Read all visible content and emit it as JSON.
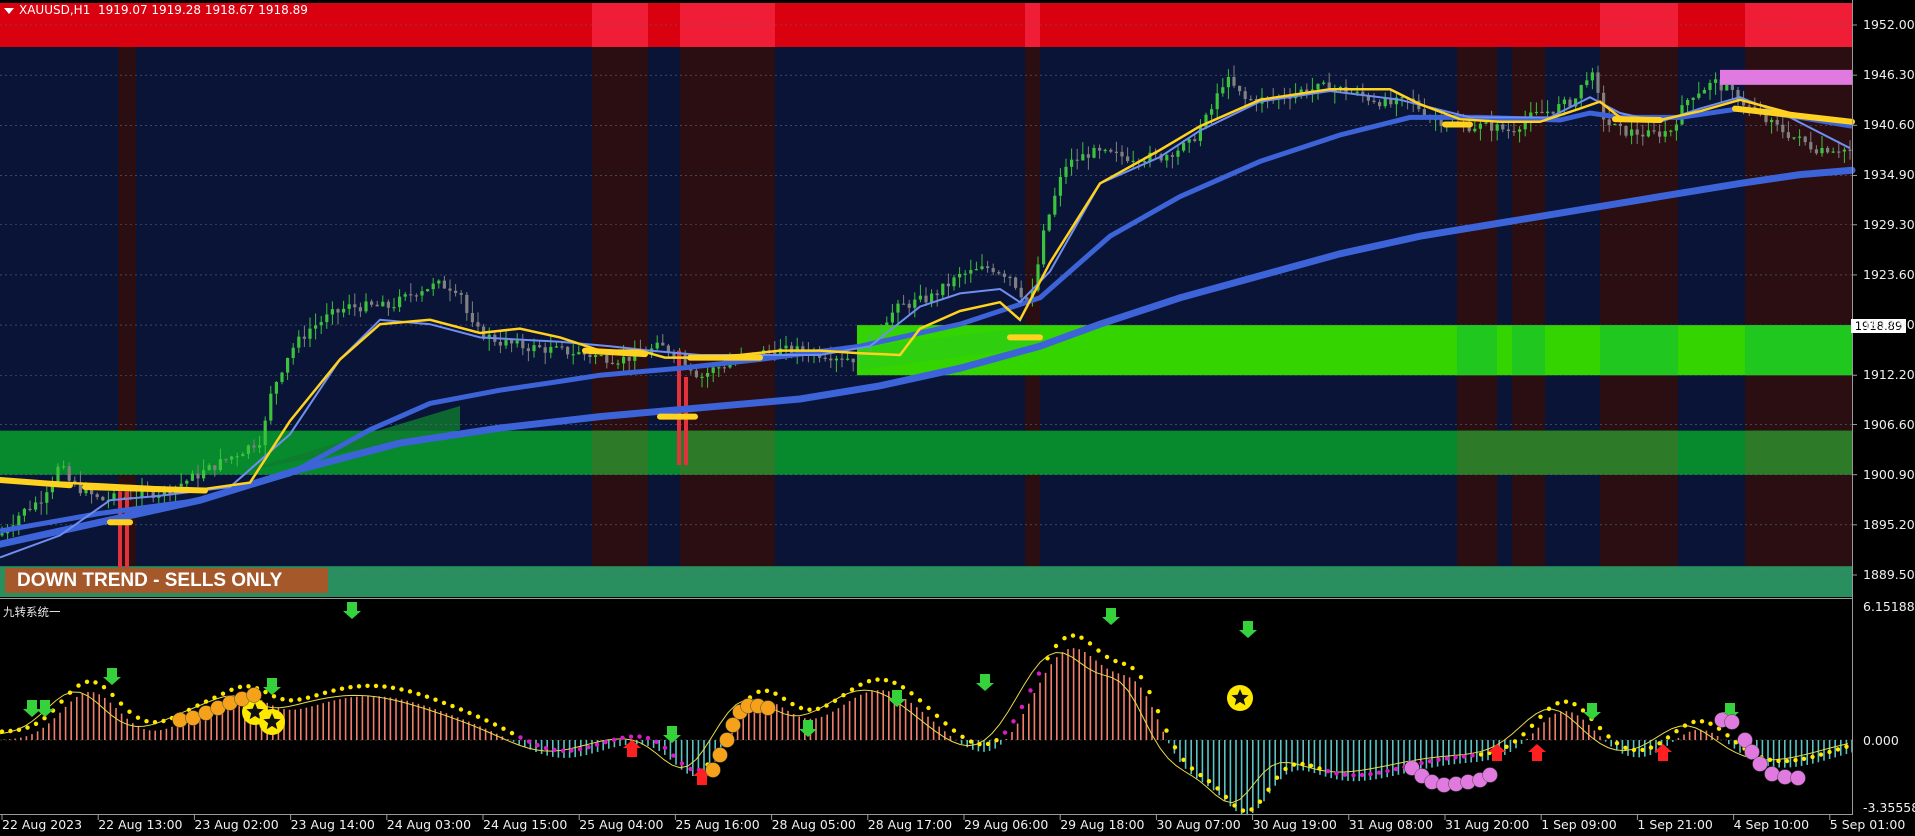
{
  "header": {
    "symbol": "XAUUSD,H1",
    "ohlc": "1919.07 1919.28 1918.67 1918.89"
  },
  "banner": {
    "text": "DOWN TREND - SELLS ONLY"
  },
  "price_axis": {
    "ticks": [
      "1952.00",
      "1946.30",
      "1940.60",
      "1934.90",
      "1929.30",
      "1923.60",
      "1917.90",
      "1912.20",
      "1906.60",
      "1900.90",
      "1895.20",
      "1889.50"
    ],
    "current_price": "1918.89"
  },
  "indicator": {
    "name": "九转系统一",
    "max_label": "6.15188",
    "zero_label": "0.000",
    "min_label": "-3.355586"
  },
  "time_axis": {
    "ticks": [
      "22 Aug 2023",
      "22 Aug 13:00",
      "23 Aug 02:00",
      "23 Aug 14:00",
      "24 Aug 03:00",
      "24 Aug 15:00",
      "25 Aug 04:00",
      "25 Aug 16:00",
      "28 Aug 05:00",
      "28 Aug 17:00",
      "29 Aug 06:00",
      "29 Aug 18:00",
      "30 Aug 07:00",
      "30 Aug 19:00",
      "31 Aug 08:00",
      "31 Aug 20:00",
      "1 Sep 09:00",
      "1 Sep 21:00",
      "4 Sep 10:00",
      "5 Sep 01:00"
    ]
  },
  "colors": {
    "background": "#000000",
    "main_bg": "#0a1436",
    "bull_candle": "#3cc23c",
    "bear_candle": "#808080",
    "fast_ma": "#ffd21f",
    "slow_ma": "#3d63d8",
    "resistance_band": "#d9000f",
    "support_zone_bright": "#33d400",
    "support_zone_dark": "#078a2e"
  },
  "chart_data": {
    "type": "candlestick",
    "symbol": "XAUUSD",
    "timeframe": "H1",
    "ylim": [
      1887.0,
      1954.5
    ],
    "last_price": 1918.89,
    "close_path": [
      [
        0,
        1894
      ],
      [
        20,
        1896.5
      ],
      [
        40,
        1898
      ],
      [
        60,
        1902
      ],
      [
        70,
        1900
      ],
      [
        85,
        1899
      ],
      [
        100,
        1898
      ],
      [
        130,
        1898.5
      ],
      [
        165,
        1899
      ],
      [
        200,
        1901
      ],
      [
        240,
        1903.5
      ],
      [
        262,
        1905
      ],
      [
        272,
        1910.5
      ],
      [
        290,
        1915
      ],
      [
        310,
        1917.5
      ],
      [
        330,
        1919
      ],
      [
        350,
        1920
      ],
      [
        370,
        1920
      ],
      [
        390,
        1920
      ],
      [
        420,
        1922
      ],
      [
        440,
        1922.5
      ],
      [
        460,
        1922
      ],
      [
        470,
        1918
      ],
      [
        480,
        1917
      ],
      [
        500,
        1916
      ],
      [
        520,
        1915.5
      ],
      [
        560,
        1915
      ],
      [
        590,
        1914.5
      ],
      [
        620,
        1914
      ],
      [
        640,
        1914.5
      ],
      [
        660,
        1915.5
      ],
      [
        680,
        1914.5
      ],
      [
        700,
        1912
      ],
      [
        715,
        1913
      ],
      [
        740,
        1914
      ],
      [
        770,
        1915
      ],
      [
        800,
        1915
      ],
      [
        830,
        1914.5
      ],
      [
        860,
        1914
      ],
      [
        868,
        1916
      ],
      [
        880,
        1918
      ],
      [
        900,
        1920
      ],
      [
        930,
        1921
      ],
      [
        960,
        1923.5
      ],
      [
        990,
        1924.5
      ],
      [
        1010,
        1923.5
      ],
      [
        1030,
        1920
      ],
      [
        1045,
        1929
      ],
      [
        1065,
        1936
      ],
      [
        1090,
        1937.5
      ],
      [
        1130,
        1937
      ],
      [
        1160,
        1937
      ],
      [
        1190,
        1938.5
      ],
      [
        1210,
        1942
      ],
      [
        1225,
        1946
      ],
      [
        1245,
        1943.5
      ],
      [
        1270,
        1943.5
      ],
      [
        1300,
        1944.5
      ],
      [
        1330,
        1945
      ],
      [
        1360,
        1944
      ],
      [
        1390,
        1943
      ],
      [
        1410,
        1943.5
      ],
      [
        1430,
        1941.5
      ],
      [
        1460,
        1940.5
      ],
      [
        1490,
        1940.5
      ],
      [
        1510,
        1940
      ],
      [
        1530,
        1941.5
      ],
      [
        1555,
        1942.5
      ],
      [
        1575,
        1943.5
      ],
      [
        1590,
        1947
      ],
      [
        1605,
        1941
      ],
      [
        1620,
        1940
      ],
      [
        1650,
        1939.5
      ],
      [
        1670,
        1940
      ],
      [
        1690,
        1944
      ],
      [
        1715,
        1945.5
      ],
      [
        1735,
        1944
      ],
      [
        1760,
        1941.5
      ],
      [
        1790,
        1939.5
      ],
      [
        1815,
        1938
      ],
      [
        1840,
        1938
      ],
      [
        1852,
        1937.5
      ]
    ],
    "fast_ma": [
      [
        0,
        1900.3
      ],
      [
        100,
        1899.8
      ],
      [
        200,
        1899.2
      ],
      [
        250,
        1900
      ],
      [
        290,
        1907
      ],
      [
        340,
        1914
      ],
      [
        380,
        1918
      ],
      [
        430,
        1918.5
      ],
      [
        480,
        1917
      ],
      [
        520,
        1917.5
      ],
      [
        560,
        1916.5
      ],
      [
        600,
        1915
      ],
      [
        640,
        1915
      ],
      [
        665,
        1914.2
      ],
      [
        700,
        1914.2
      ],
      [
        740,
        1914.5
      ],
      [
        780,
        1915
      ],
      [
        820,
        1915
      ],
      [
        860,
        1914.7
      ],
      [
        900,
        1914.5
      ],
      [
        920,
        1917.5
      ],
      [
        960,
        1919.5
      ],
      [
        1000,
        1920.5
      ],
      [
        1020,
        1918.5
      ],
      [
        1050,
        1925
      ],
      [
        1100,
        1934
      ],
      [
        1160,
        1937.8
      ],
      [
        1200,
        1940.5
      ],
      [
        1260,
        1943.5
      ],
      [
        1330,
        1944.7
      ],
      [
        1390,
        1944.7
      ],
      [
        1420,
        1943
      ],
      [
        1460,
        1941.3
      ],
      [
        1500,
        1941
      ],
      [
        1540,
        1941
      ],
      [
        1580,
        1942.5
      ],
      [
        1600,
        1943.3
      ],
      [
        1620,
        1941.5
      ],
      [
        1660,
        1941.2
      ],
      [
        1700,
        1942.2
      ],
      [
        1740,
        1943.5
      ],
      [
        1790,
        1942
      ],
      [
        1850,
        1941
      ]
    ],
    "mid_ma": [
      [
        0,
        1891.5
      ],
      [
        60,
        1894
      ],
      [
        110,
        1898
      ],
      [
        160,
        1898.5
      ],
      [
        230,
        1899.5
      ],
      [
        290,
        1905.5
      ],
      [
        340,
        1914
      ],
      [
        380,
        1918.5
      ],
      [
        430,
        1918
      ],
      [
        480,
        1916.5
      ],
      [
        560,
        1916
      ],
      [
        610,
        1915.5
      ],
      [
        650,
        1915
      ],
      [
        700,
        1914.5
      ],
      [
        760,
        1914.5
      ],
      [
        820,
        1914.5
      ],
      [
        870,
        1915.5
      ],
      [
        920,
        1920
      ],
      [
        960,
        1921.5
      ],
      [
        1000,
        1922
      ],
      [
        1020,
        1920.5
      ],
      [
        1050,
        1924
      ],
      [
        1100,
        1934
      ],
      [
        1160,
        1937
      ],
      [
        1200,
        1940
      ],
      [
        1260,
        1943.3
      ],
      [
        1330,
        1944.5
      ],
      [
        1400,
        1943.5
      ],
      [
        1470,
        1941.5
      ],
      [
        1550,
        1941.5
      ],
      [
        1590,
        1943.8
      ],
      [
        1620,
        1942
      ],
      [
        1660,
        1941
      ],
      [
        1700,
        1942.5
      ],
      [
        1740,
        1943.8
      ],
      [
        1790,
        1941.5
      ],
      [
        1850,
        1938
      ]
    ],
    "slow_ma": [
      [
        0,
        1894.5
      ],
      [
        100,
        1896.5
      ],
      [
        200,
        1898
      ],
      [
        290,
        1901
      ],
      [
        370,
        1906
      ],
      [
        430,
        1909
      ],
      [
        500,
        1910.5
      ],
      [
        560,
        1911.5
      ],
      [
        600,
        1912.2
      ],
      [
        680,
        1913
      ],
      [
        760,
        1914
      ],
      [
        860,
        1915.5
      ],
      [
        960,
        1918
      ],
      [
        1040,
        1921
      ],
      [
        1110,
        1928
      ],
      [
        1180,
        1932.5
      ],
      [
        1260,
        1936.5
      ],
      [
        1340,
        1939.5
      ],
      [
        1410,
        1941.5
      ],
      [
        1480,
        1941.5
      ],
      [
        1560,
        1941.2
      ],
      [
        1590,
        1942
      ],
      [
        1620,
        1941.5
      ],
      [
        1680,
        1941.5
      ],
      [
        1740,
        1942.5
      ],
      [
        1800,
        1941.5
      ],
      [
        1852,
        1940.5
      ]
    ],
    "long_ma": [
      [
        0,
        1893
      ],
      [
        100,
        1895.5
      ],
      [
        200,
        1898
      ],
      [
        300,
        1901.5
      ],
      [
        400,
        1904.5
      ],
      [
        500,
        1906.2
      ],
      [
        600,
        1907.5
      ],
      [
        700,
        1908.5
      ],
      [
        800,
        1909.5
      ],
      [
        880,
        1911
      ],
      [
        960,
        1913
      ],
      [
        1040,
        1915.5
      ],
      [
        1100,
        1918
      ],
      [
        1180,
        1921
      ],
      [
        1260,
        1923.5
      ],
      [
        1340,
        1926
      ],
      [
        1420,
        1928
      ],
      [
        1500,
        1929.5
      ],
      [
        1580,
        1931
      ],
      [
        1660,
        1932.5
      ],
      [
        1740,
        1934
      ],
      [
        1800,
        1935
      ],
      [
        1852,
        1935.5
      ]
    ],
    "resistance_band": [
      1949.5,
      1954.5
    ],
    "support_zone_upper": [
      1912.2,
      1917.9
    ],
    "support_zone_middle": [
      1900.9,
      1905.9
    ],
    "support_zone_bottom": [
      1887.0,
      1890.5
    ]
  }
}
